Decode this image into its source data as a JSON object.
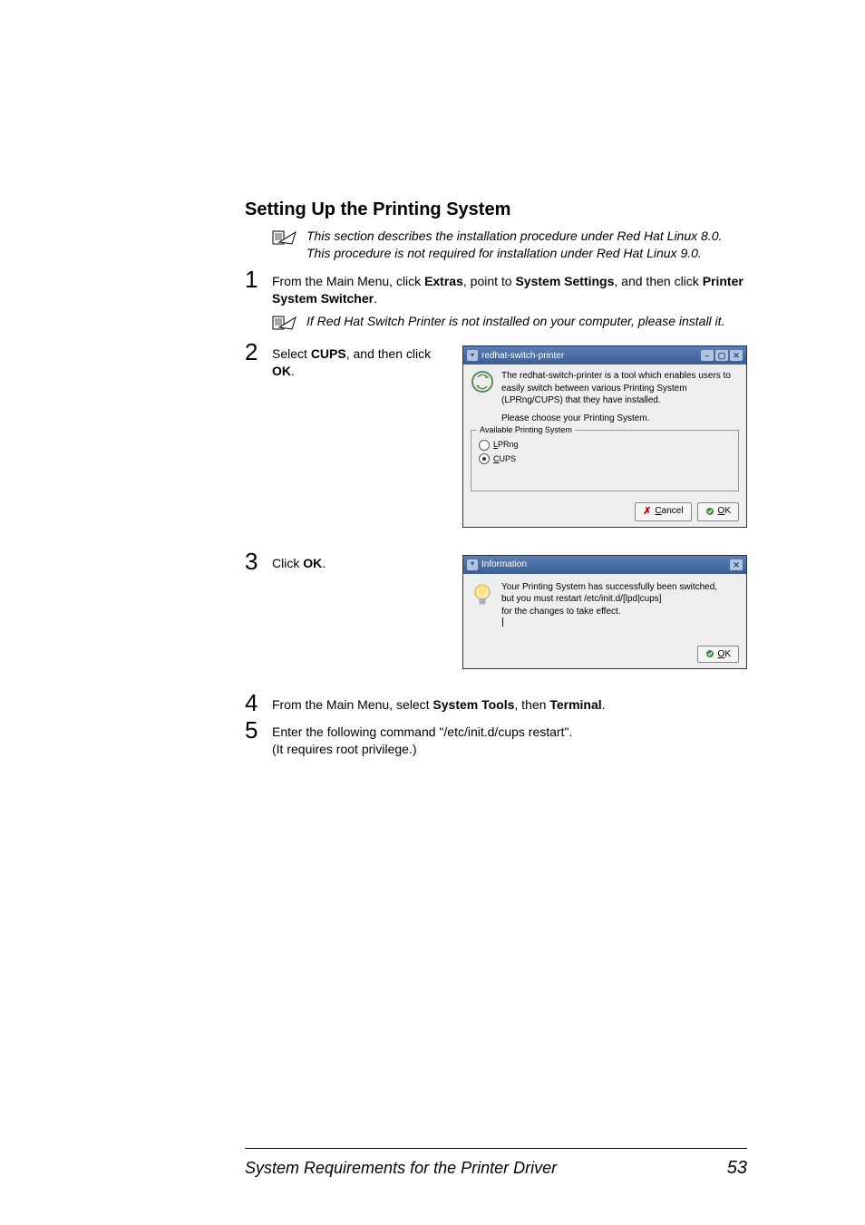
{
  "heading": "Setting Up the Printing System",
  "note_icon_name": "note-icon",
  "note1": "This section describes the installation procedure under Red Hat Linux 8.0. This procedure is not required for installation under Red Hat Linux 9.0.",
  "step1_num": "1",
  "step1_a": "From the Main Menu, click ",
  "step1_b": "Extras",
  "step1_c": ", point to ",
  "step1_d": "System Settings",
  "step1_e": ", and then click ",
  "step1_f": "Printer System Switcher",
  "step1_g": ".",
  "note2": "If Red Hat Switch Printer is not installed on your computer, please install it.",
  "step2_num": "2",
  "step2_a": "Select ",
  "step2_b": "CUPS",
  "step2_c": ", and then click ",
  "step2_d": "OK",
  "step2_e": ".",
  "dialog1": {
    "title": "redhat-switch-printer",
    "desc": "The redhat-switch-printer is a tool which enables users to easily switch between various Printing System (LPRng/CUPS) that they have installed.",
    "prompt": "Please choose your Printing System.",
    "legend": "Available Printing System",
    "radio1": "LPRng",
    "radio2": "CUPS",
    "cancel": "Cancel",
    "ok": "OK"
  },
  "step3_num": "3",
  "step3_a": "Click ",
  "step3_b": "OK",
  "step3_c": ".",
  "dialog2": {
    "title": "Information",
    "line1": "Your Printing System has successfully been switched,",
    "line2": "but you must restart /etc/init.d/[lpd|cups]",
    "line3": "for the changes to take effect.",
    "ok": "OK"
  },
  "step4_num": "4",
  "step4_a": "From the Main Menu, select ",
  "step4_b": "System Tools",
  "step4_c": ", then ",
  "step4_d": "Terminal",
  "step4_e": ".",
  "step5_num": "5",
  "step5_a": "Enter the following command \"/etc/init.d/cups restart\".",
  "step5_b": "(It requires root privilege.)",
  "footer_title": "System Requirements for the Printer Driver",
  "footer_page": "53"
}
